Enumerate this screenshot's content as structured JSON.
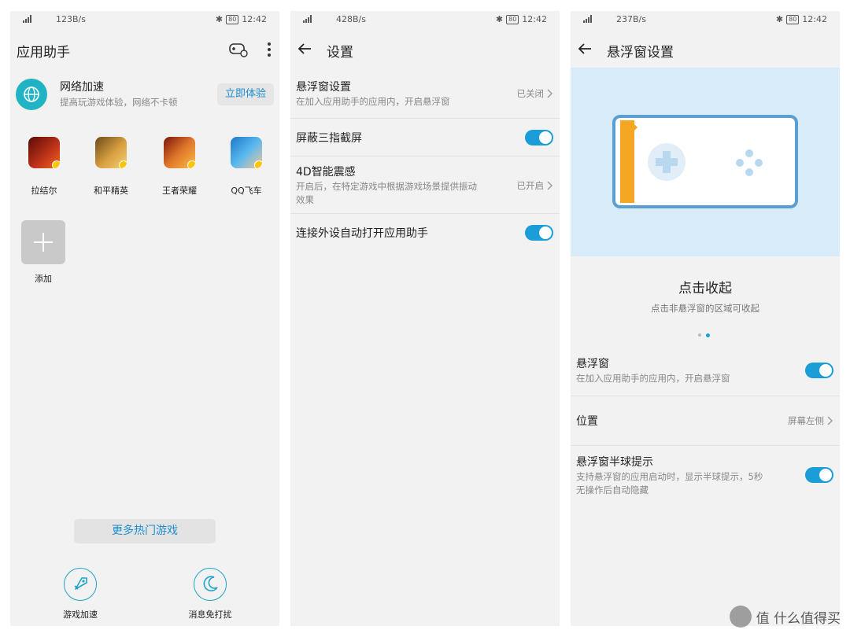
{
  "screen1": {
    "status": {
      "speed": "123B/s",
      "time": "12:42",
      "battery": "80"
    },
    "title": "应用助手",
    "net_boost": {
      "title": "网络加速",
      "subtitle": "提高玩游戏体验，网络不卡顿",
      "button": "立即体验"
    },
    "games": [
      {
        "label": "拉结尔",
        "color": "#8a1c12"
      },
      {
        "label": "和平精英",
        "color": "#c98a2a"
      },
      {
        "label": "王者荣耀",
        "color": "#d65a1e"
      },
      {
        "label": "QQ飞车",
        "color": "#3aa0e0"
      }
    ],
    "add_label": "添加",
    "more_button": "更多热门游戏",
    "bottom_actions": [
      {
        "label": "游戏加速",
        "icon": "rocket-icon"
      },
      {
        "label": "消息免打扰",
        "icon": "moon-icon"
      }
    ]
  },
  "screen2": {
    "status": {
      "speed": "428B/s",
      "time": "12:42",
      "battery": "80"
    },
    "title": "设置",
    "items": [
      {
        "title": "悬浮窗设置",
        "subtitle": "在加入应用助手的应用内，开启悬浮窗",
        "value": "已关闭"
      },
      {
        "title": "屏蔽三指截屏"
      },
      {
        "title": "4D智能震感",
        "subtitle_line1": "开启后，在特定游戏中根据游戏场景提供振动",
        "subtitle_line2": "效果",
        "value": "已开启"
      },
      {
        "title": "连接外设自动打开应用助手"
      }
    ]
  },
  "screen3": {
    "status": {
      "speed": "237B/s",
      "time": "12:42",
      "battery": "80"
    },
    "title": "悬浮窗设置",
    "banner_title": "点击收起",
    "banner_subtitle": "点击非悬浮窗的区域可收起",
    "items": [
      {
        "title": "悬浮窗",
        "subtitle": "在加入应用助手的应用内，开启悬浮窗"
      },
      {
        "title": "位置",
        "value": "屏幕左侧"
      },
      {
        "title": "悬浮窗半球提示",
        "subtitle_line1": "支持悬浮窗的应用启动时，显示半球提示，5秒",
        "subtitle_line2": "无操作后自动隐藏"
      }
    ]
  },
  "watermark": "值 什么值得买",
  "colors": {
    "accent": "#1b9ed8",
    "banner": "#d7ecf8",
    "orange": "#f5a623"
  }
}
